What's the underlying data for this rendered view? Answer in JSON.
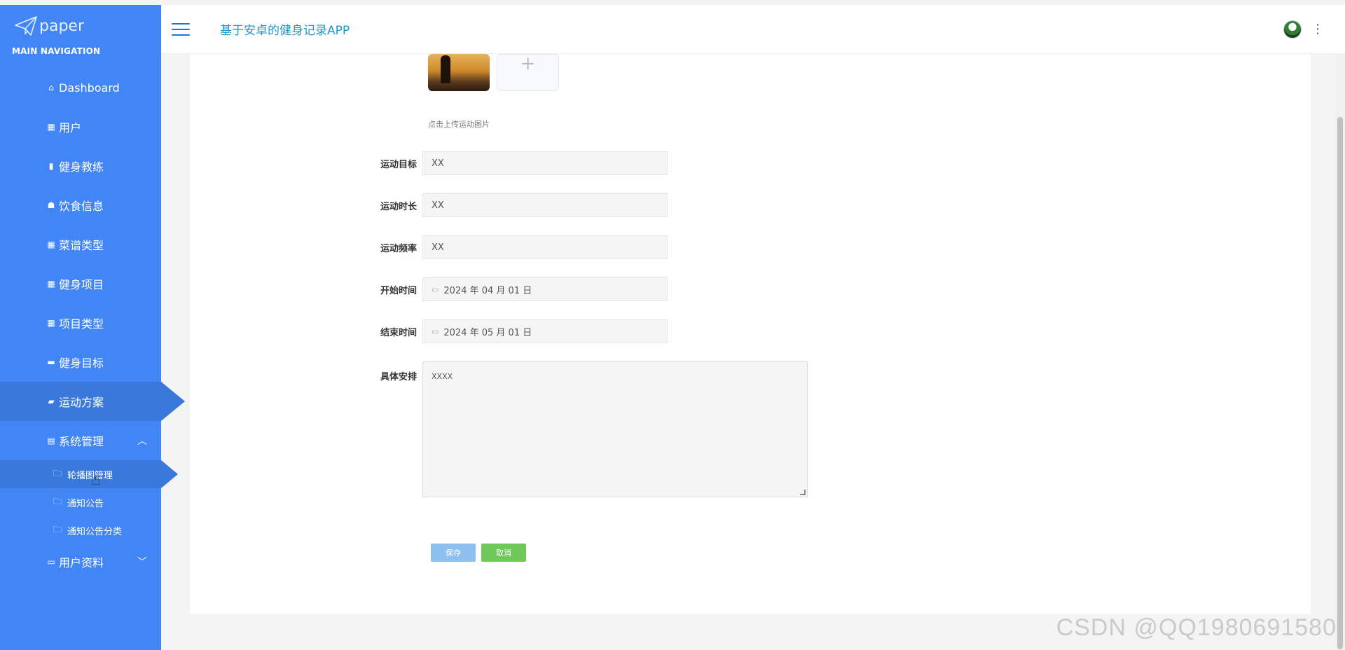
{
  "brand": {
    "name": "paper"
  },
  "sidebar": {
    "header": "MAIN NAVIGATION",
    "items": [
      {
        "label": "Dashboard",
        "icon": "home-icon"
      },
      {
        "label": "用户",
        "icon": "grid-icon"
      },
      {
        "label": "健身教练",
        "icon": "bar-chart-icon"
      },
      {
        "label": "饮食信息",
        "icon": "thumbs-up-icon"
      },
      {
        "label": "菜谱类型",
        "icon": "grid-icon"
      },
      {
        "label": "健身项目",
        "icon": "grid-icon"
      },
      {
        "label": "项目类型",
        "icon": "grid-icon"
      },
      {
        "label": "健身目标",
        "icon": "monitor-icon"
      },
      {
        "label": "运动方案",
        "icon": "briefcase-icon",
        "active": true
      },
      {
        "label": "系统管理",
        "icon": "clipboard-icon",
        "expanded": true
      }
    ],
    "sub_items": [
      {
        "label": "轮播图管理",
        "icon": "folder-icon",
        "active": true
      },
      {
        "label": "通知公告",
        "icon": "folder-icon"
      },
      {
        "label": "通知公告分类",
        "icon": "folder-icon"
      }
    ],
    "last_item": {
      "label": "用户资料",
      "icon": "calendar-icon",
      "expanded": false
    }
  },
  "header": {
    "title": "基于安卓的健身记录APP"
  },
  "form": {
    "upload_hint": "点击上传运动图片",
    "fields": [
      {
        "label": "运动目标",
        "value": "XX"
      },
      {
        "label": "运动时长",
        "value": "XX"
      },
      {
        "label": "运动频率",
        "value": "XX"
      },
      {
        "label": "开始时间",
        "value": "2024 年 04 月 01 日"
      },
      {
        "label": "结束时间",
        "value": "2024 年 05 月 01 日"
      }
    ],
    "arrangement": {
      "label": "具体安排",
      "value": "XXXX"
    },
    "save_label": "保存",
    "cancel_label": "取消"
  },
  "watermark": "CSDN @QQ1980691580",
  "colors": {
    "sidebar": "#4285f4",
    "active": "#3a78dc",
    "title": "#2196c9",
    "save": "#8dc0ef",
    "cancel": "#6fc85a"
  }
}
